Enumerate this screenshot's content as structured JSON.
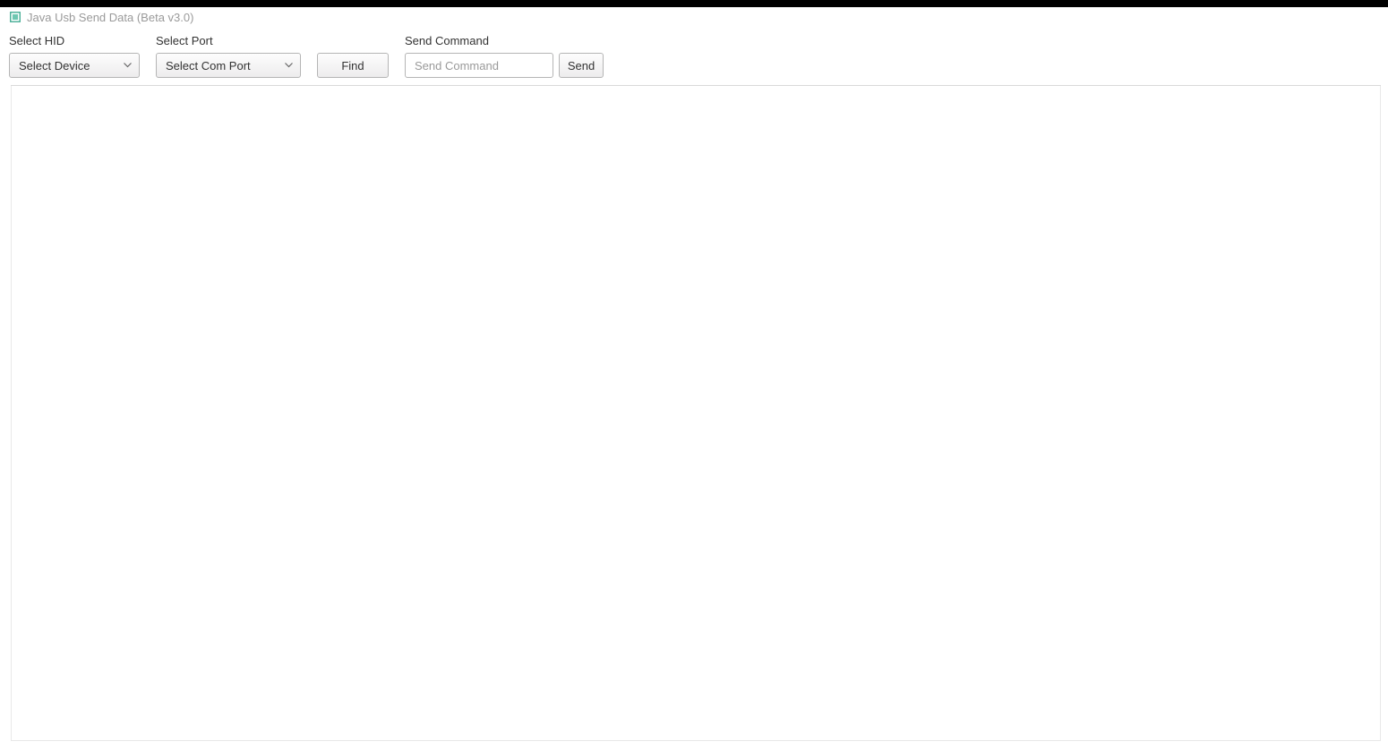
{
  "window": {
    "title": "Java Usb Send Data (Beta v3.0)"
  },
  "toolbar": {
    "hid": {
      "label": "Select HID",
      "selected": "Select Device"
    },
    "port": {
      "label": "Select Port",
      "selected": "Select Com Port"
    },
    "find": {
      "label": "Find"
    },
    "command": {
      "label": "Send Command",
      "placeholder": "Send Command",
      "value": ""
    },
    "send": {
      "label": "Send"
    }
  }
}
